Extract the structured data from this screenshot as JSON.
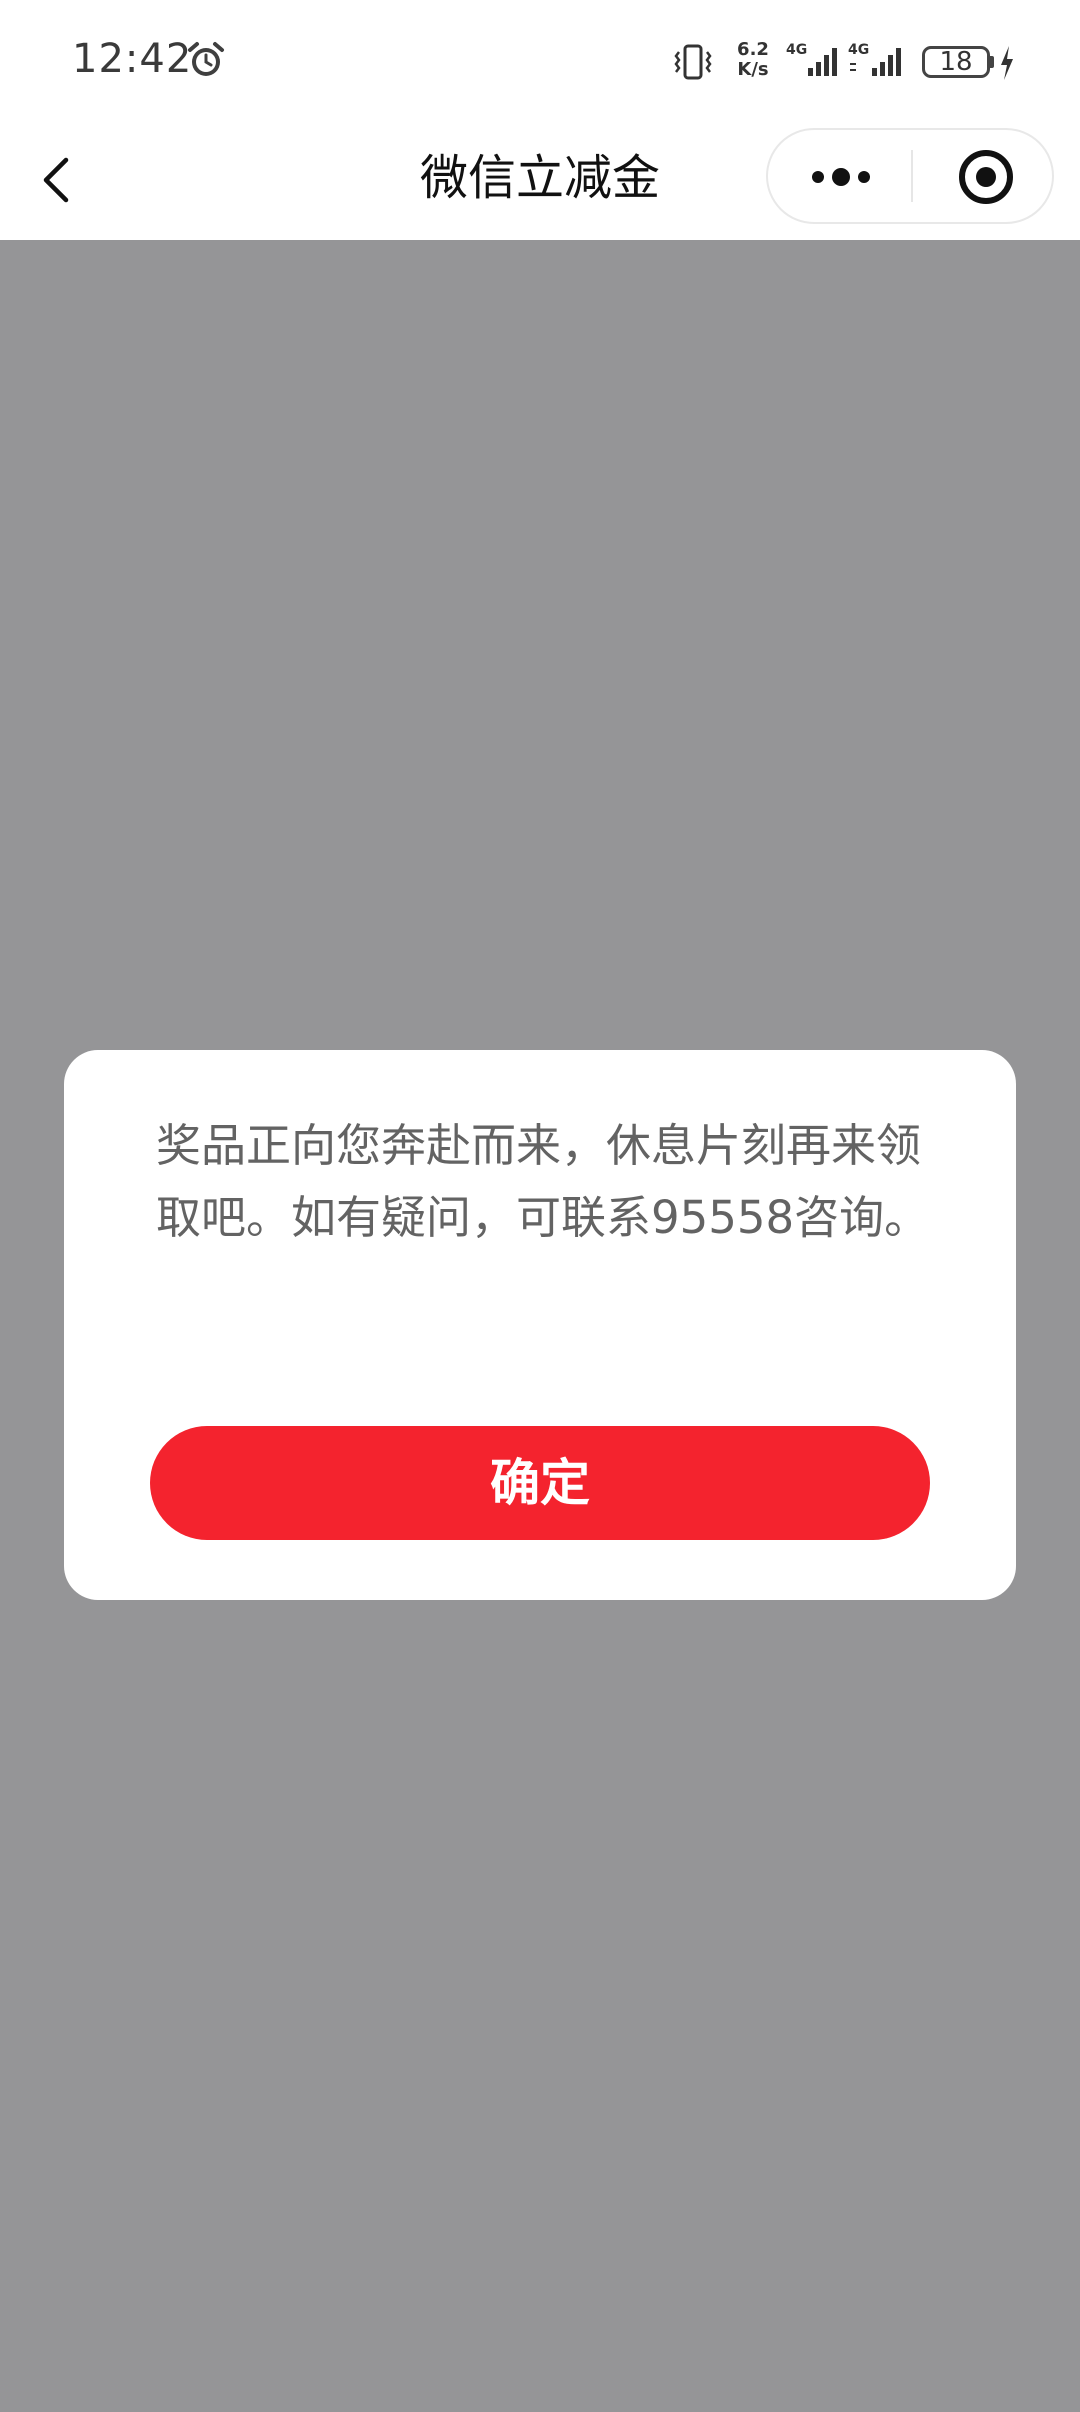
{
  "status_bar": {
    "time": "12:42",
    "net_speed_value": "6.2",
    "net_speed_unit": "K/s",
    "signal_1_label": "4G",
    "signal_2_label": "4G",
    "battery_level": "18",
    "icons": [
      "alarm-icon",
      "vibrate-icon",
      "signal-icon",
      "battery-icon",
      "charging-icon"
    ]
  },
  "nav": {
    "title": "微信立减金",
    "icons": [
      "back-arrow-icon",
      "more-dots-icon",
      "close-target-icon"
    ]
  },
  "dialog": {
    "message": "奖品正向您奔赴而来，休息片刻再来领取吧。如有疑问，可联系95558咨询。",
    "confirm_label": "确定"
  },
  "colors": {
    "overlay": "#959597",
    "button_red": "#f4232e",
    "message_text": "#636363"
  }
}
